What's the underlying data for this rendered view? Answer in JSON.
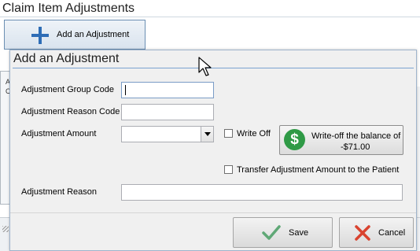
{
  "background": {
    "title": "Claim Item Adjustments",
    "add_button_label": "Add an Adjustment",
    "strip_letters": [
      "A",
      "C"
    ]
  },
  "dialog": {
    "title": "Add an Adjustment",
    "fields": {
      "group_code_label": "Adjustment Group Code",
      "group_code_value": "",
      "reason_code_label": "Adjustment Reason Code",
      "reason_code_value": "",
      "amount_label": "Adjustment Amount",
      "amount_value": "",
      "reason_label": "Adjustment Reason",
      "reason_value": ""
    },
    "write_off_label": "Write Off",
    "write_off_checked": false,
    "write_off_button_line1": "Write-off the balance of",
    "write_off_button_line2": "-$71.00",
    "transfer_label": "Transfer Adjustment Amount to the Patient",
    "transfer_checked": false,
    "save_label": "Save",
    "cancel_label": "Cancel"
  },
  "colors": {
    "accent": "#2e6db6",
    "money_green": "#2f9a46",
    "check_green": "#5fa876",
    "cancel_red": "#d9432f"
  },
  "icons": [
    "plus-icon",
    "dollar-icon",
    "checkmark-icon",
    "x-icon",
    "mouse-pointer-icon"
  ]
}
